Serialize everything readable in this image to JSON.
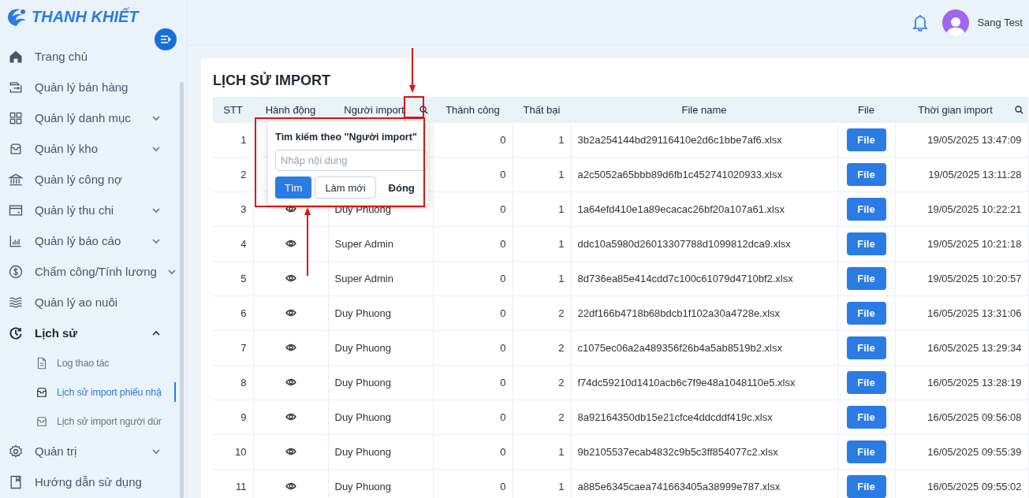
{
  "brand": {
    "name": "THANH KHIẾT"
  },
  "sidebar": {
    "items": [
      {
        "label": "Trang chủ",
        "selected": false
      },
      {
        "label": "Quản lý bán hàng",
        "selected": false
      },
      {
        "label": "Quản lý danh mục",
        "selected": false,
        "expanded": false
      },
      {
        "label": "Quản lý kho",
        "selected": false,
        "expanded": false
      },
      {
        "label": "Quản lý công nợ",
        "selected": false
      },
      {
        "label": "Quản lý thu chi",
        "selected": false,
        "expanded": false
      },
      {
        "label": "Quản lý báo cáo",
        "selected": false,
        "expanded": false
      },
      {
        "label": "Chấm công/Tính lương",
        "selected": false,
        "expanded": false
      },
      {
        "label": "Quản lý ao nuôi",
        "selected": false
      },
      {
        "label": "Lịch sử",
        "selected": true,
        "expanded": true,
        "children": [
          {
            "label": "Log thao tác",
            "selected": false
          },
          {
            "label": "Lịch sử import phiếu nhậ",
            "selected": true
          },
          {
            "label": "Lịch sử import người dùr",
            "selected": false
          }
        ]
      },
      {
        "label": "Quản trị",
        "selected": false,
        "expanded": false
      },
      {
        "label": "Hướng dẫn sử dụng",
        "selected": false
      }
    ]
  },
  "header": {
    "user": "Sang Test"
  },
  "page": {
    "title": "LỊCH SỬ IMPORT"
  },
  "table": {
    "columns": [
      {
        "label": "STT",
        "searchable": false
      },
      {
        "label": "Hành động",
        "searchable": false
      },
      {
        "label": "Người import",
        "searchable": true
      },
      {
        "label": "Thành công",
        "searchable": false
      },
      {
        "label": "Thất bại",
        "searchable": false
      },
      {
        "label": "File name",
        "searchable": false
      },
      {
        "label": "File",
        "searchable": false
      },
      {
        "label": "Thời gian import",
        "searchable": true
      }
    ],
    "rows": [
      {
        "stt": "1",
        "success": "0",
        "failed": "1",
        "file_name": "3b2a254144bd29116410e2d6c1bbe7af6.xlsx",
        "file_button": "File",
        "time": "19/05/2025 13:47:09"
      },
      {
        "stt": "2",
        "success": "0",
        "failed": "1",
        "file_name": "a2c5052a65bbb89d6fb1c452741020933.xlsx",
        "file_button": "File",
        "time": "19/05/2025 13:11:28"
      },
      {
        "stt": "3",
        "user": "Duy Phuong",
        "success": "0",
        "failed": "1",
        "file_name": "1a64efd410e1a89ecacac26bf20a107a61.xlsx",
        "file_button": "File",
        "time": "19/05/2025 10:22:21"
      },
      {
        "stt": "4",
        "user": "Super Admin",
        "success": "0",
        "failed": "1",
        "file_name": "ddc10a5980d26013307788d1099812dca9.xlsx",
        "file_button": "File",
        "time": "19/05/2025 10:21:18"
      },
      {
        "stt": "5",
        "user": "Super Admin",
        "success": "0",
        "failed": "1",
        "file_name": "8d736ea85e414cdd7c100c61079d4710bf2.xlsx",
        "file_button": "File",
        "time": "19/05/2025 10:20:57"
      },
      {
        "stt": "6",
        "user": "Duy Phuong",
        "success": "0",
        "failed": "2",
        "file_name": "22df166b4718b68bdcb1f102a30a4728e.xlsx",
        "file_button": "File",
        "time": "16/05/2025 13:31:06"
      },
      {
        "stt": "7",
        "user": "Duy Phuong",
        "success": "0",
        "failed": "2",
        "file_name": "c1075ec06a2a489356f26b4a5ab8519b2.xlsx",
        "file_button": "File",
        "time": "16/05/2025 13:29:34"
      },
      {
        "stt": "8",
        "user": "Duy Phuong",
        "success": "0",
        "failed": "2",
        "file_name": "f74dc59210d1410acb6c7f9e48a1048110e5.xlsx",
        "file_button": "File",
        "time": "16/05/2025 13:28:19"
      },
      {
        "stt": "9",
        "user": "Duy Phuong",
        "success": "0",
        "failed": "2",
        "file_name": "8a92164350db15e21cfce4ddcddf419c.xlsx",
        "file_button": "File",
        "time": "16/05/2025 09:56:08"
      },
      {
        "stt": "10",
        "user": "Duy Phuong",
        "success": "0",
        "failed": "1",
        "file_name": "9b2105537ecab4832c9b5c3ff854077c2.xlsx",
        "file_button": "File",
        "time": "16/05/2025 09:55:39"
      },
      {
        "stt": "11",
        "user": "Duy Phuong",
        "success": "0",
        "failed": "1",
        "file_name": "a885e6345caea741663405a38999e787.xlsx",
        "file_button": "File",
        "time": "16/05/2025 09:55:02"
      }
    ]
  },
  "search_popup": {
    "title": "Tìm kiếm theo \"Người import\"",
    "placeholder": "Nhập nội dung",
    "buttons": [
      {
        "label": "Tìm",
        "kind": "primary"
      },
      {
        "label": "Làm mới",
        "kind": "outline"
      },
      {
        "label": "Đóng",
        "kind": "text"
      }
    ]
  }
}
